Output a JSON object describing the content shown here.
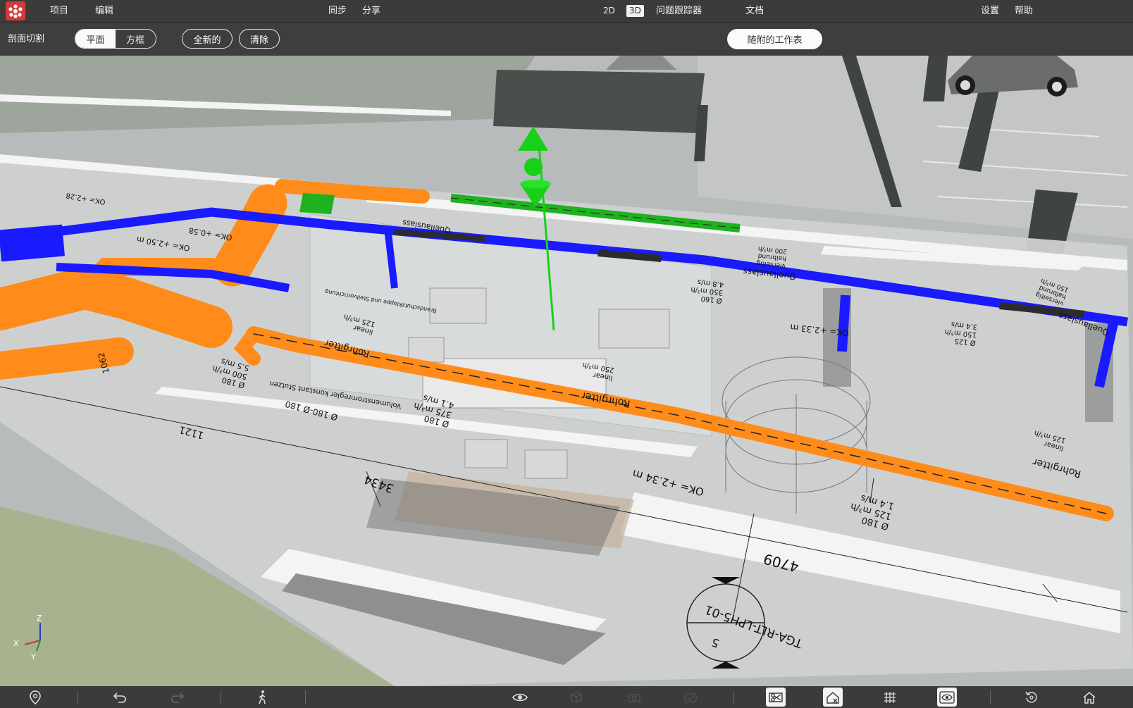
{
  "topbar": {
    "menu_project": "项目",
    "menu_edit": "编辑",
    "sync": "同步",
    "share": "分享",
    "view_2d": "2D",
    "view_3d": "3D",
    "issue_tracker": "问题跟踪器",
    "documents": "文档",
    "settings": "设置",
    "help": "帮助"
  },
  "subbar": {
    "section_cut": "剖面切割",
    "mode_plane": "平面",
    "mode_box": "方框",
    "new_button": "全新的",
    "clear_button": "清除",
    "attached_sheet": "随附的工作表",
    "active_mode": "平面"
  },
  "scene": {
    "labels": {
      "quellauslass_1": "Quellauslass",
      "quellauslass_1_note": "vierseitig\nhalbrund\n200 m³/h",
      "quellauslass_2": "Quellauslass",
      "quellauslass_2_note": "vierseitig\nhalbrund\n150 m³/h",
      "quellauslass_3": "Quellauslass",
      "dim_350": "Ø 160\n350 m³/h\n4.8 m/s",
      "dim_150": "Ø 125\n150 m³/h\n3.4 m/s",
      "ok_233": "OK= +2.33 m",
      "ok_234": "OK= +2.34 m",
      "rohrgitter_1": "Rohrgitter",
      "rohrgitter_1_note": "linear\n250 m³/h",
      "rohrgitter_2": "Rohrgitter",
      "rohrgitter_2_note": "linear\n125 m³/h",
      "rohrgitter_3": "Rohrgitter",
      "rohrgitter_3_note": "linear\n125 m³/h",
      "dim_375": "Ø 180\n375 m³/h\n4.1 m/s",
      "dim_125": "Ø 180\n125 m³/h\n1.4 m/s",
      "dim_500": "Ø 180\n500 m³/h\n5.5 m/s",
      "volumenstrom": "Volumenstromregler konstant Stutzen",
      "phi180": "Ø 180-Ø 180",
      "dim_4709": "4709",
      "dim_3434": "3434",
      "dim_1121": "1121",
      "dim_1062": "1062",
      "ok_058": "OK= +0.58",
      "ok_250": "OK= +2.50 m",
      "ok_228": "OK= +2.28",
      "tga_label": "TGA-RLT-LPH5-01",
      "tga_num": "5",
      "brandschutz": "Brandschutzklappe und Stellvorrichtung"
    },
    "axis": {
      "x": "X",
      "y": "Y",
      "z": "Z"
    },
    "colors": {
      "supply_duct": "#ff8c1a",
      "exhaust_duct": "#1a1aff",
      "green_duct": "#1fb21f",
      "gizmo": "#19d019"
    }
  },
  "bottombar": {
    "icons": [
      "location-pin-icon",
      "undo-icon",
      "redo-icon",
      "walk-icon",
      "eye-icon",
      "cube-icon",
      "camera-icon",
      "camera-check-icon",
      "section-cut-icon",
      "home-crop-icon",
      "grid-icon",
      "view-eye-icon",
      "rotate-reset-icon",
      "home-icon"
    ],
    "active": [
      "section-cut-icon",
      "home-crop-icon",
      "view-eye-icon"
    ]
  }
}
